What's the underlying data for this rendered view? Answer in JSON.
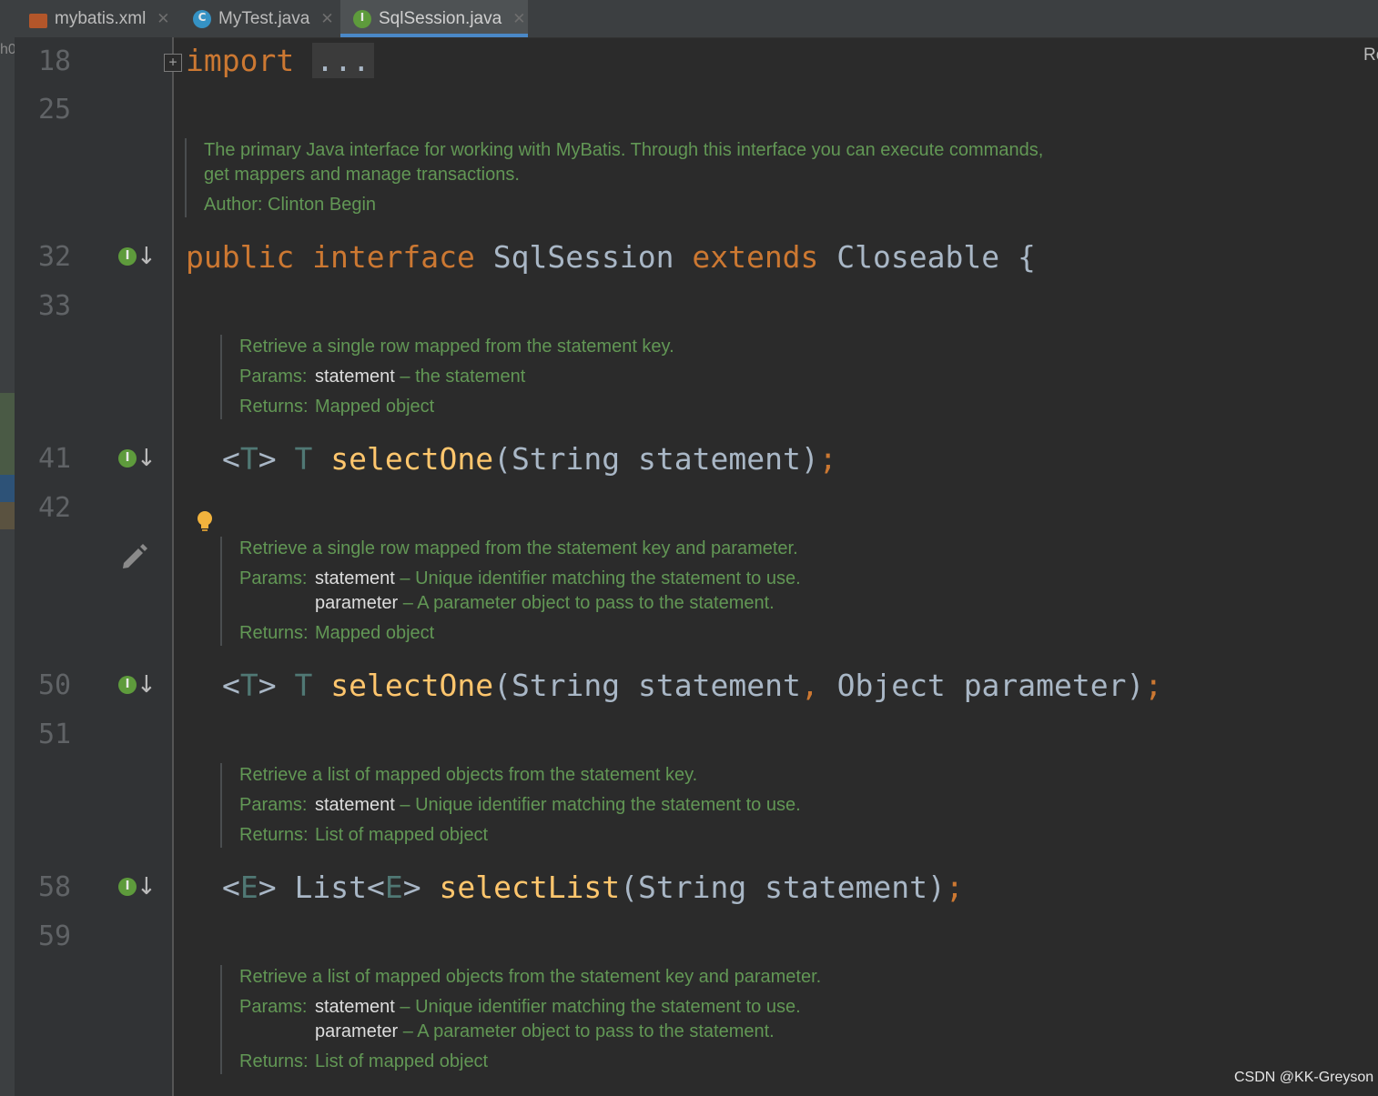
{
  "tabs": [
    {
      "label": "mybatis.xml",
      "icon": "xml-file-icon",
      "active": false
    },
    {
      "label": "MyTest.java",
      "icon": "java-class-icon",
      "active": false
    },
    {
      "label": "SqlSession.java",
      "icon": "java-interface-icon",
      "active": true
    }
  ],
  "side_text": {
    "left": "h0",
    "right": "Re"
  },
  "gutter": {
    "line_numbers": [
      "18",
      "25",
      "32",
      "33",
      "41",
      "42",
      "50",
      "51",
      "58",
      "59"
    ],
    "interface_icon_letter": "I",
    "class_icon_letter": "C"
  },
  "code": {
    "import_kw": "import",
    "import_fold": "...",
    "decl": {
      "public": "public",
      "interface": "interface",
      "name": "SqlSession",
      "extends": "extends",
      "parent": "Closeable",
      "brace": "{"
    },
    "methods": [
      {
        "type_param": "T",
        "return": "T",
        "name": "selectOne",
        "params": [
          {
            "type": "String",
            "name": "statement"
          }
        ]
      },
      {
        "type_param": "T",
        "return": "T",
        "name": "selectOne",
        "params": [
          {
            "type": "String",
            "name": "statement"
          },
          {
            "type": "Object",
            "name": "parameter"
          }
        ]
      },
      {
        "type_param": "E",
        "return": "List",
        "name": "selectList",
        "params": [
          {
            "type": "String",
            "name": "statement"
          }
        ]
      }
    ]
  },
  "docs": {
    "class": {
      "line1": "The primary Java interface for working with MyBatis. Through this interface you can execute commands,",
      "line2": "get mappers and manage transactions.",
      "author": "Author: Clinton Begin"
    },
    "m1": {
      "desc": "Retrieve a single row mapped from the statement key.",
      "params_label": "Params:",
      "p1_name": "statement",
      "p1_desc": " – the statement",
      "returns_label": "Returns:",
      "returns": "Mapped object"
    },
    "m2": {
      "desc": "Retrieve a single row mapped from the statement key and parameter.",
      "params_label": "Params:",
      "p1_name": "statement",
      "p1_desc": " – Unique identifier matching the statement to use.",
      "p2_name": "parameter",
      "p2_desc": " – A parameter object to pass to the statement.",
      "returns_label": "Returns:",
      "returns": "Mapped object"
    },
    "m3": {
      "desc": "Retrieve a list of mapped objects from the statement key.",
      "params_label": "Params:",
      "p1_name": "statement",
      "p1_desc": " – Unique identifier matching the statement to use.",
      "returns_label": "Returns:",
      "returns": "List of mapped object"
    },
    "m4": {
      "desc": "Retrieve a list of mapped objects from the statement key and parameter.",
      "params_label": "Params:",
      "p1_name": "statement",
      "p1_desc": " – Unique identifier matching the statement to use.",
      "p2_name": "parameter",
      "p2_desc": " – A parameter object to pass to the statement.",
      "returns_label": "Returns:",
      "returns": "List of mapped object"
    }
  },
  "watermark": "CSDN @KK-Greyson",
  "colors": {
    "background": "#2b2b2b",
    "keyword": "#cc7832",
    "method": "#ffc66d",
    "doc": "#629755",
    "type_param": "#507874",
    "accent": "#4a88c7"
  }
}
